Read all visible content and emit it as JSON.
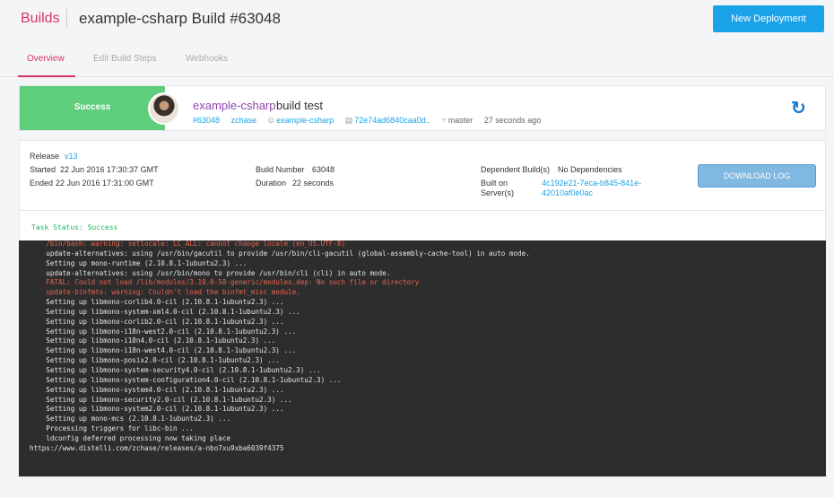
{
  "header": {
    "builds_link": "Builds",
    "title": "example-csharp Build #63048",
    "new_deployment": "New Deployment"
  },
  "tabs": [
    {
      "label": "Overview",
      "active": true
    },
    {
      "label": "Edit Build Steps",
      "active": false
    },
    {
      "label": "Webhooks",
      "active": false
    }
  ],
  "summary": {
    "status": "Success",
    "app_name": "example-csharp",
    "description": "build test",
    "build_id": "#63048",
    "user": "zchase",
    "repo": "example-csharp",
    "commit": "72e74ad6840caa0d..",
    "branch": "master",
    "time_ago": "27 seconds ago"
  },
  "details": {
    "release_label": "Release",
    "release_value": "v13",
    "started_label": "Started",
    "started_value": "22 Jun 2016 17:30:37 GMT",
    "ended_label": "Ended",
    "ended_value": "22 Jun 2016 17:31:00 GMT",
    "build_number_label": "Build Number",
    "build_number_value": "63048",
    "duration_label": "Duration",
    "duration_value": "22 seconds",
    "dependent_label": "Dependent Build(s)",
    "dependent_value": "No Dependencies",
    "built_on_label_1": "Built on",
    "built_on_label_2": "Server(s)",
    "built_on_value_1": "4c192e21-7eca-b845-841e-",
    "built_on_value_2": "42010af0e0ac",
    "download_log": "DOWNLOAD LOG",
    "task_status": "Task Status: Success"
  },
  "log": [
    {
      "text": "    /bin/bash: warning: setlocale: LC_ALL: cannot change locale (en_US.UTF-8)",
      "err": true
    },
    {
      "text": "    update-alternatives: using /usr/bin/gacutil to provide /usr/bin/cli-gacutil (global-assembly-cache-tool) in auto mode.",
      "err": false
    },
    {
      "text": "    Setting up mono-runtime (2.10.8.1-1ubuntu2.3) ...",
      "err": false
    },
    {
      "text": "    update-alternatives: using /usr/bin/mono to provide /usr/bin/cli (cli) in auto mode.",
      "err": false
    },
    {
      "text": "    FATAL: Could not load /lib/modules/3.19.0-58-generic/modules.dep: No such file or directory",
      "err": true
    },
    {
      "text": "    update-binfmts: warning: Couldn't load the binfmt_misc module.",
      "err": true
    },
    {
      "text": "    Setting up libmono-corlib4.0-cil (2.10.8.1-1ubuntu2.3) ...",
      "err": false
    },
    {
      "text": "    Setting up libmono-system-xml4.0-cil (2.10.8.1-1ubuntu2.3) ...",
      "err": false
    },
    {
      "text": "    Setting up libmono-corlib2.0-cil (2.10.8.1-1ubuntu2.3) ...",
      "err": false
    },
    {
      "text": "    Setting up libmono-i18n-west2.0-cil (2.10.8.1-1ubuntu2.3) ...",
      "err": false
    },
    {
      "text": "    Setting up libmono-i18n4.0-cil (2.10.8.1-1ubuntu2.3) ...",
      "err": false
    },
    {
      "text": "    Setting up libmono-i18n-west4.0-cil (2.10.8.1-1ubuntu2.3) ...",
      "err": false
    },
    {
      "text": "    Setting up libmono-posix2.0-cil (2.10.8.1-1ubuntu2.3) ...",
      "err": false
    },
    {
      "text": "    Setting up libmono-system-security4.0-cil (2.10.8.1-1ubuntu2.3) ...",
      "err": false
    },
    {
      "text": "    Setting up libmono-system-configuration4.0-cil (2.10.8.1-1ubuntu2.3) ...",
      "err": false
    },
    {
      "text": "    Setting up libmono-system4.0-cil (2.10.8.1-1ubuntu2.3) ...",
      "err": false
    },
    {
      "text": "    Setting up libmono-security2.0-cil (2.10.8.1-1ubuntu2.3) ...",
      "err": false
    },
    {
      "text": "    Setting up libmono-system2.0-cil (2.10.8.1-1ubuntu2.3) ...",
      "err": false
    },
    {
      "text": "    Setting up mono-mcs (2.10.8.1-1ubuntu2.3) ...",
      "err": false
    },
    {
      "text": "    Processing triggers for libc-bin ...",
      "err": false
    },
    {
      "text": "    ldconfig deferred processing now taking place",
      "err": false
    },
    {
      "text": "https://www.distelli.com/zchase/releases/a-nbo7xu9xba6039f4375",
      "err": false
    }
  ],
  "colors": {
    "accent": "#d6336c",
    "primary_button": "#1aa3e8",
    "success": "#5ece7d",
    "error_text": "#e8644f",
    "log_bg": "#2d2d2d"
  }
}
